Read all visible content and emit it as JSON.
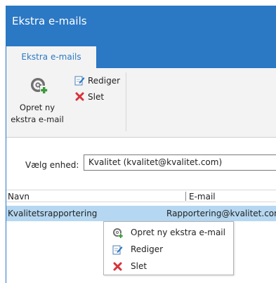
{
  "window": {
    "title": "Ekstra e-mails"
  },
  "ribbon": {
    "tab_label": "Ekstra e-mails",
    "create_label_line1": "Opret ny",
    "create_label_line2": "ekstra e-mail",
    "edit_label": "Rediger",
    "delete_label": "Slet"
  },
  "device": {
    "label": "Vælg enhed:",
    "selected": "Kvalitet (kvalitet@kvalitet.com)"
  },
  "list": {
    "columns": [
      "Navn",
      "E-mail"
    ],
    "rows": [
      {
        "name": "Kvalitetsrapportering",
        "email": "Rapportering@kvalitet.com"
      }
    ]
  },
  "context_menu": {
    "items": [
      "Opret ny ekstra e-mail",
      "Rediger",
      "Slet"
    ]
  },
  "colors": {
    "accent": "#2b78c4",
    "selection": "#b5d7f1",
    "delete_red": "#d9323a",
    "add_green": "#3a9a3a"
  },
  "icons": [
    "at-add-icon",
    "edit-icon",
    "delete-icon"
  ]
}
